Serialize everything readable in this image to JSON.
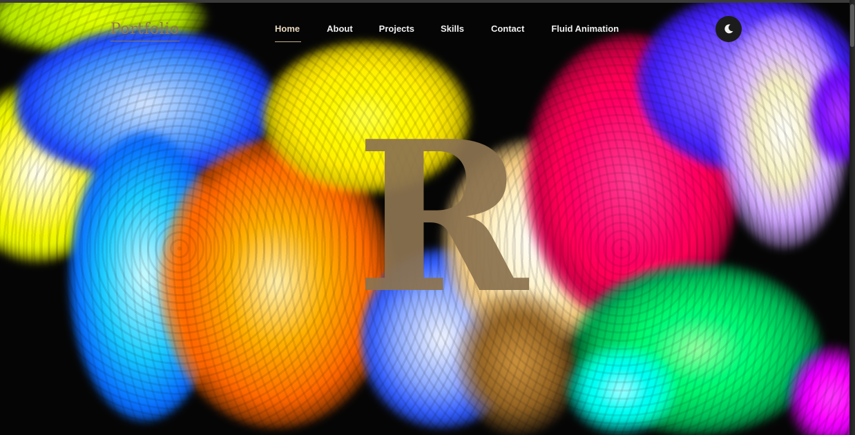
{
  "logo": {
    "text": "Portfolio"
  },
  "nav": {
    "items": [
      {
        "label": "Home",
        "active": true
      },
      {
        "label": "About",
        "active": false
      },
      {
        "label": "Projects",
        "active": false
      },
      {
        "label": "Skills",
        "active": false
      },
      {
        "label": "Contact",
        "active": false
      },
      {
        "label": "Fluid Animation",
        "active": false
      }
    ]
  },
  "theme_toggle": {
    "icon": "moon-icon"
  },
  "hero": {
    "letter": "R"
  },
  "colors": {
    "accent": "#8c7350",
    "background": "#050505",
    "nav_text": "#f0f0f0"
  }
}
